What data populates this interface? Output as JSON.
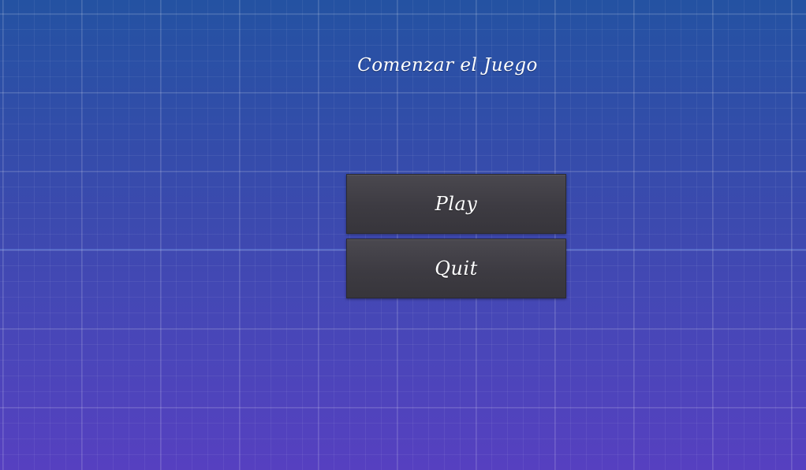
{
  "title": "Comenzar el Juego",
  "buttons": {
    "play": "Play",
    "quit": "Quit"
  },
  "colors": {
    "background_top": "#2452a2",
    "background_bottom": "#5640c0",
    "button": "#403e45",
    "text": "#ffffff"
  }
}
